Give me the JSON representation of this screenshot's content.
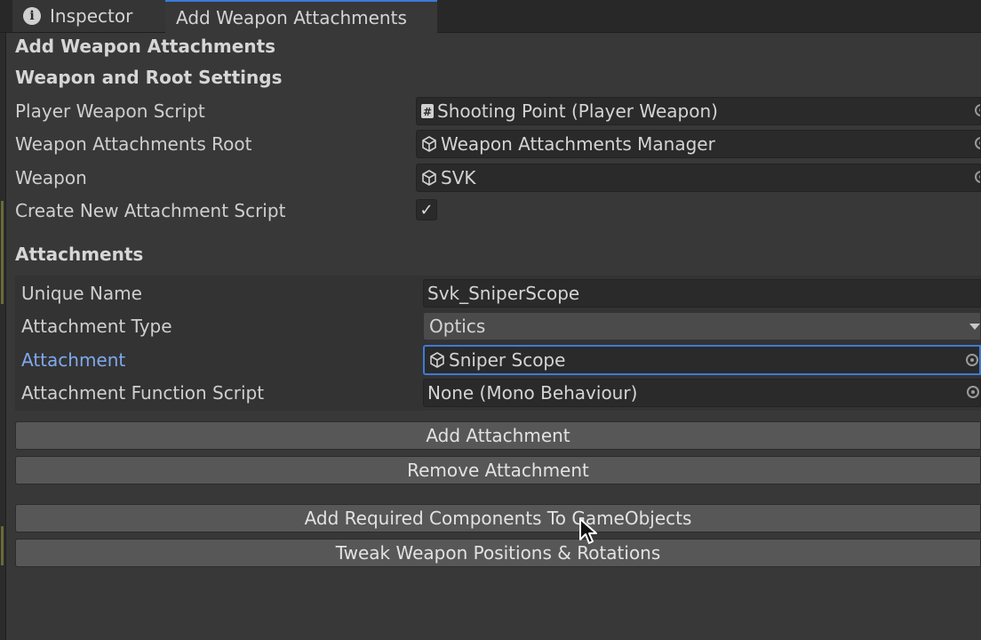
{
  "tabs": [
    {
      "label": "Inspector",
      "icon": "info-icon"
    },
    {
      "label": "Add Weapon Attachments",
      "active": true
    }
  ],
  "panel": {
    "title": "Add Weapon Attachments",
    "weapon_section": {
      "header": "Weapon and Root Settings",
      "fields": [
        {
          "label": "Player Weapon Script",
          "value": "Shooting Point (Player Weapon)",
          "icon": "script-icon"
        },
        {
          "label": "Weapon Attachments Root",
          "value": "Weapon Attachments Manager",
          "icon": "cube-icon"
        },
        {
          "label": "Weapon",
          "value": "SVK",
          "icon": "cube-icon"
        }
      ],
      "checkbox": {
        "label": "Create New Attachment Script",
        "checked": true,
        "glyph": "✓"
      }
    },
    "attachments_section": {
      "header": "Attachments",
      "fields": [
        {
          "label": "Unique Name",
          "value": "Svk_SniperScope"
        },
        {
          "label": "Attachment Type",
          "value": "Optics",
          "type": "dropdown"
        },
        {
          "label": "Attachment",
          "value": "Sniper Scope",
          "icon": "cube-icon",
          "focused": true
        },
        {
          "label": "Attachment Function Script",
          "value": "None (Mono Behaviour)"
        }
      ]
    },
    "buttons": {
      "add_attachment": "Add Attachment",
      "remove_attachment": "Remove Attachment",
      "add_required_components": "Add Required Components To GameObjects",
      "tweak_positions": "Tweak Weapon Positions & Rotations"
    }
  },
  "colors": {
    "background": "#383838",
    "tab_accent": "#3a7ad8",
    "focused_label": "#7fa9ee"
  }
}
